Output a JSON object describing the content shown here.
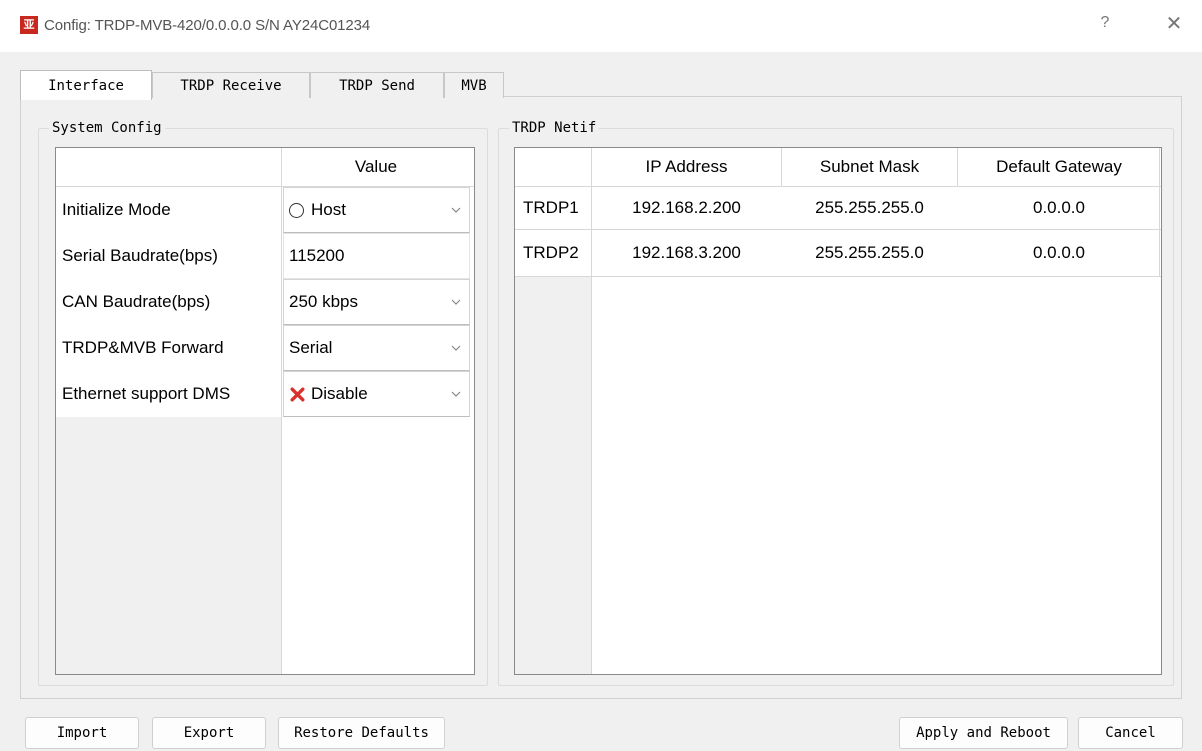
{
  "window": {
    "app_icon": "亚",
    "title": "Config: TRDP-MVB-420/0.0.0.0 S/N AY24C01234",
    "help_label": "?",
    "close_label": "✕"
  },
  "tabs": [
    {
      "label": "Interface",
      "active": true
    },
    {
      "label": "TRDP Receive",
      "active": false
    },
    {
      "label": "TRDP Send",
      "active": false
    },
    {
      "label": "MVB",
      "active": false
    }
  ],
  "system_config": {
    "title": "System Config",
    "value_header": "Value",
    "rows": [
      {
        "label": "Initialize Mode",
        "value": "Host",
        "icon": "radio-empty-icon"
      },
      {
        "label": "Serial Baudrate(bps)",
        "value": "115200"
      },
      {
        "label": "CAN Baudrate(bps)",
        "value": "250 kbps"
      },
      {
        "label": "TRDP&MVB Forward",
        "value": "Serial"
      },
      {
        "label": "Ethernet support DMS",
        "value": "Disable",
        "icon": "red-x-icon"
      }
    ]
  },
  "trdp_netif": {
    "title": "TRDP Netif",
    "headers": [
      "IP Address",
      "Subnet Mask",
      "Default Gateway"
    ],
    "rows": [
      {
        "name": "TRDP1",
        "ip": "192.168.2.200",
        "mask": "255.255.255.0",
        "gateway": "0.0.0.0"
      },
      {
        "name": "TRDP2",
        "ip": "192.168.3.200",
        "mask": "255.255.255.0",
        "gateway": "0.0.0.0"
      }
    ]
  },
  "buttons": {
    "import": "Import",
    "export": "Export",
    "restore": "Restore Defaults",
    "apply": "Apply and Reboot",
    "cancel": "Cancel"
  },
  "colors": {
    "icon_red": "#c8281e",
    "x_red": "#d9312b"
  }
}
